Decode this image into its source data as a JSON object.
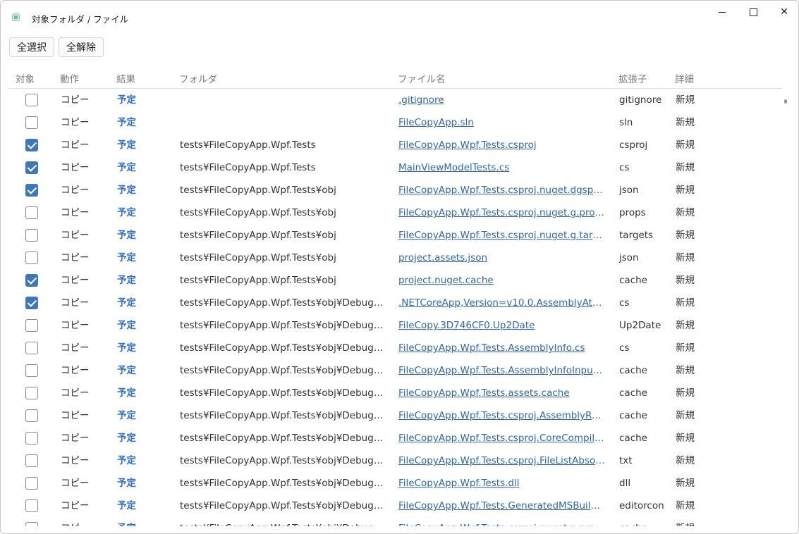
{
  "window": {
    "title": "対象フォルダ / ファイル",
    "controls": {
      "minimize": "minimize",
      "maximize": "maximize",
      "close": "✕"
    }
  },
  "toolbar": {
    "select_all_label": "全選択",
    "deselect_all_label": "全解除"
  },
  "table": {
    "headers": {
      "target": "対象",
      "action": "動作",
      "result": "結果",
      "folder": "フォルダ",
      "file": "ファイル名",
      "ext": "拡張子",
      "detail": "詳細"
    },
    "rows": [
      {
        "checked": false,
        "action": "コピー",
        "result": "予定",
        "folder": "",
        "file": ".gitignore",
        "ext": "gitignore",
        "detail": "新規"
      },
      {
        "checked": false,
        "action": "コピー",
        "result": "予定",
        "folder": "",
        "file": "FileCopyApp.sln",
        "ext": "sln",
        "detail": "新規"
      },
      {
        "checked": true,
        "action": "コピー",
        "result": "予定",
        "folder": "tests¥FileCopyApp.Wpf.Tests",
        "file": "FileCopyApp.Wpf.Tests.csproj",
        "ext": "csproj",
        "detail": "新規"
      },
      {
        "checked": true,
        "action": "コピー",
        "result": "予定",
        "folder": "tests¥FileCopyApp.Wpf.Tests",
        "file": "MainViewModelTests.cs",
        "ext": "cs",
        "detail": "新規"
      },
      {
        "checked": true,
        "action": "コピー",
        "result": "予定",
        "folder": "tests¥FileCopyApp.Wpf.Tests¥obj",
        "file": "FileCopyApp.Wpf.Tests.csproj.nuget.dgspec.js...",
        "ext": "json",
        "detail": "新規"
      },
      {
        "checked": false,
        "action": "コピー",
        "result": "予定",
        "folder": "tests¥FileCopyApp.Wpf.Tests¥obj",
        "file": "FileCopyApp.Wpf.Tests.csproj.nuget.g.props",
        "ext": "props",
        "detail": "新規"
      },
      {
        "checked": false,
        "action": "コピー",
        "result": "予定",
        "folder": "tests¥FileCopyApp.Wpf.Tests¥obj",
        "file": "FileCopyApp.Wpf.Tests.csproj.nuget.g.targets",
        "ext": "targets",
        "detail": "新規"
      },
      {
        "checked": false,
        "action": "コピー",
        "result": "予定",
        "folder": "tests¥FileCopyApp.Wpf.Tests¥obj",
        "file": "project.assets.json",
        "ext": "json",
        "detail": "新規"
      },
      {
        "checked": true,
        "action": "コピー",
        "result": "予定",
        "folder": "tests¥FileCopyApp.Wpf.Tests¥obj",
        "file": "project.nuget.cache",
        "ext": "cache",
        "detail": "新規"
      },
      {
        "checked": true,
        "action": "コピー",
        "result": "予定",
        "folder": "tests¥FileCopyApp.Wpf.Tests¥obj¥Debug¥net...",
        "file": ".NETCoreApp,Version=v10.0.AssemblyAttribut...",
        "ext": "cs",
        "detail": "新規"
      },
      {
        "checked": false,
        "action": "コピー",
        "result": "予定",
        "folder": "tests¥FileCopyApp.Wpf.Tests¥obj¥Debug¥net...",
        "file": "FileCopy.3D746CF0.Up2Date",
        "ext": "Up2Date",
        "detail": "新規"
      },
      {
        "checked": false,
        "action": "コピー",
        "result": "予定",
        "folder": "tests¥FileCopyApp.Wpf.Tests¥obj¥Debug¥net...",
        "file": "FileCopyApp.Wpf.Tests.AssemblyInfo.cs",
        "ext": "cs",
        "detail": "新規"
      },
      {
        "checked": false,
        "action": "コピー",
        "result": "予定",
        "folder": "tests¥FileCopyApp.Wpf.Tests¥obj¥Debug¥net...",
        "file": "FileCopyApp.Wpf.Tests.AssemblyInfoInputs.ca...",
        "ext": "cache",
        "detail": "新規"
      },
      {
        "checked": false,
        "action": "コピー",
        "result": "予定",
        "folder": "tests¥FileCopyApp.Wpf.Tests¥obj¥Debug¥net...",
        "file": "FileCopyApp.Wpf.Tests.assets.cache",
        "ext": "cache",
        "detail": "新規"
      },
      {
        "checked": false,
        "action": "コピー",
        "result": "予定",
        "folder": "tests¥FileCopyApp.Wpf.Tests¥obj¥Debug¥net...",
        "file": "FileCopyApp.Wpf.Tests.csproj.AssemblyRefere...",
        "ext": "cache",
        "detail": "新規"
      },
      {
        "checked": false,
        "action": "コピー",
        "result": "予定",
        "folder": "tests¥FileCopyApp.Wpf.Tests¥obj¥Debug¥net...",
        "file": "FileCopyApp.Wpf.Tests.csproj.CoreCompileInp...",
        "ext": "cache",
        "detail": "新規"
      },
      {
        "checked": false,
        "action": "コピー",
        "result": "予定",
        "folder": "tests¥FileCopyApp.Wpf.Tests¥obj¥Debug¥net...",
        "file": "FileCopyApp.Wpf.Tests.csproj.FileListAbsolute....",
        "ext": "txt",
        "detail": "新規"
      },
      {
        "checked": false,
        "action": "コピー",
        "result": "予定",
        "folder": "tests¥FileCopyApp.Wpf.Tests¥obj¥Debug¥net...",
        "file": "FileCopyApp.Wpf.Tests.dll",
        "ext": "dll",
        "detail": "新規"
      },
      {
        "checked": false,
        "action": "コピー",
        "result": "予定",
        "folder": "tests¥FileCopyApp.Wpf.Tests¥obj¥Debug¥net...",
        "file": "FileCopyApp.Wpf.Tests.GeneratedMSBuildEdit...",
        "ext": "editorcon",
        "detail": "新規"
      },
      {
        "checked": false,
        "action": "コピー",
        "result": "予定",
        "folder": "tests¥FileCopyApp.Wpf.Tests¥obj¥Debug¥net...",
        "file": "FileCopyApp.Wpf.Tests.csproj.nuget.g.props",
        "ext": "cache",
        "detail": "新規"
      }
    ]
  },
  "colors": {
    "accent": "#3f78b8",
    "result_text": "#2f6fc7",
    "link": "#2f66b0"
  }
}
